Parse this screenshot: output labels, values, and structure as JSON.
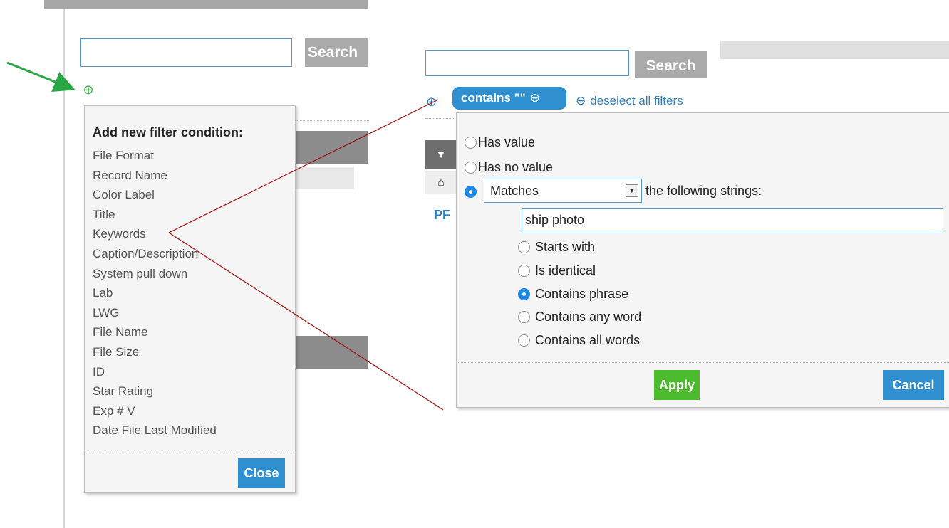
{
  "left": {
    "search": {
      "value": "",
      "button_label": "Search"
    },
    "popup": {
      "heading": "Add new filter condition:",
      "items": [
        "File Format",
        "Record Name",
        "Color Label",
        "Title",
        "Keywords",
        "Caption/Description",
        "System pull down",
        "Lab",
        "LWG",
        "File Name",
        "File Size",
        "ID",
        "Star Rating",
        "Exp # V",
        "Date File Last Modified"
      ],
      "close_label": "Close"
    }
  },
  "right": {
    "search": {
      "value": "",
      "button_label": "Search"
    },
    "filter_pill": {
      "label": "contains \"\""
    },
    "deselect_label": "deselect all filters",
    "side_text": "PF",
    "condition": {
      "options_top": [
        {
          "label": "Has value",
          "selected": false
        },
        {
          "label": "Has no value",
          "selected": false
        }
      ],
      "match_mode": {
        "selected": true,
        "value": "Matches",
        "suffix": "the following strings:"
      },
      "string_value": "ship photo",
      "sub_options": [
        {
          "label": "Starts with",
          "selected": false
        },
        {
          "label": "Is identical",
          "selected": false
        },
        {
          "label": "Contains phrase",
          "selected": true
        },
        {
          "label": "Contains any word",
          "selected": false
        },
        {
          "label": "Contains all words",
          "selected": false
        }
      ],
      "apply_label": "Apply",
      "cancel_label": "Cancel"
    }
  },
  "colors": {
    "accent_blue": "#2f8fcf",
    "apply_green": "#4cbb2e",
    "annotation_green": "#28a745",
    "annotation_red": "#a01010"
  },
  "icons": [
    "add-filter-icon",
    "remove-filter-icon",
    "home-icon",
    "dropdown-arrow-icon",
    "annotation-arrow"
  ]
}
